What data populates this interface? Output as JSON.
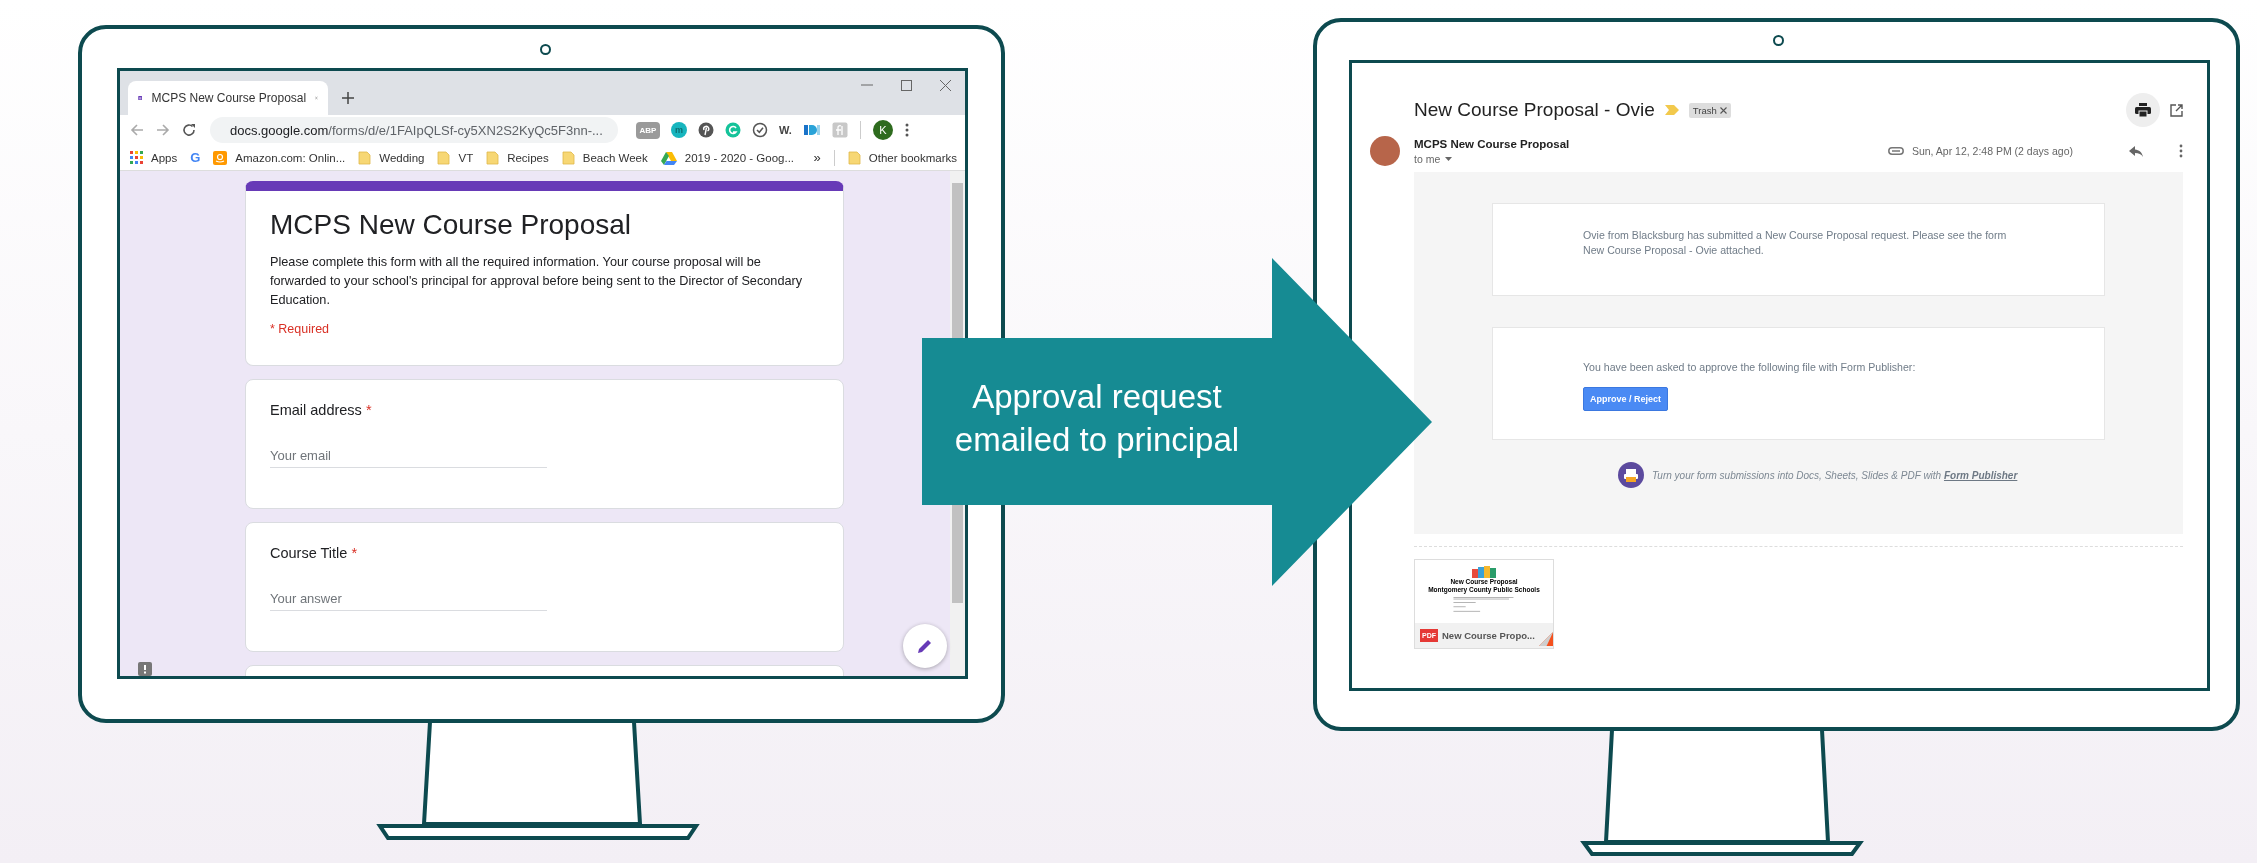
{
  "left_monitor": {
    "browser": {
      "tab": {
        "title": "MCPS New Course Proposal",
        "selected": true
      },
      "address": {
        "host": "docs.google.com",
        "path": "/forms/d/e/1FAIpQLSf-cy5XN2S2KyQc5F3nn-..."
      },
      "extensions": [
        {
          "kind": "abp",
          "label": "ABP"
        },
        {
          "kind": "m",
          "label": "m"
        },
        {
          "kind": "pin"
        },
        {
          "kind": "ring"
        },
        {
          "kind": "check"
        },
        {
          "kind": "w",
          "label": "W."
        },
        {
          "kind": "dub"
        },
        {
          "kind": "fl"
        }
      ],
      "profile": "K",
      "bookmarks": [
        {
          "kind": "apps",
          "label": "Apps"
        },
        {
          "kind": "letter",
          "label": "G"
        },
        {
          "kind": "amazon",
          "label": "Amazon.com: Onlin..."
        },
        {
          "kind": "folder",
          "label": "Wedding"
        },
        {
          "kind": "folder",
          "label": "VT"
        },
        {
          "kind": "folder",
          "label": "Recipes"
        },
        {
          "kind": "folder",
          "label": "Beach Week"
        },
        {
          "kind": "drive",
          "label": "2019 - 2020 - Goog..."
        }
      ],
      "overflow": "»",
      "other_bookmarks": "Other bookmarks"
    },
    "form": {
      "title": "MCPS New Course Proposal",
      "description": "Please complete this form with all the required information. Your course proposal will be forwarded to your school's principal for approval before being sent to the Director of Secondary Education.",
      "required_note": "* Required",
      "questions": [
        {
          "label": "Email address",
          "required_mark": "*",
          "placeholder": "Your email"
        },
        {
          "label": "Course Title",
          "required_mark": "*",
          "placeholder": "Your answer"
        }
      ],
      "more_below": true
    }
  },
  "arrow": {
    "lines": [
      "Approval request",
      "emailed to principal"
    ]
  },
  "right_monitor": {
    "email": {
      "subject": "New Course Proposal - Ovie",
      "important": true,
      "label": "Trash",
      "sender": "MCPS New Course Proposal",
      "recipient": "to me",
      "date": "Sun, Apr 12, 2:48 PM (2 days ago)",
      "message": "Ovie from Blacksburg has submitted a New Course Proposal request. Please see the form New Course Proposal - Ovie attached.",
      "approval_text": "You have been asked to approve the following file with Form Publisher:",
      "approval_button": "Approve / Reject",
      "promo": {
        "text": "Turn your form submissions into Docs, Sheets, Slides & PDF with ",
        "link": "Form Publisher"
      },
      "attachment": {
        "preview_title": "New Course Proposal",
        "preview_subtitle": "Montgomery County Public Schools",
        "badge": "PDF",
        "name": "New Course Propo..."
      }
    }
  }
}
